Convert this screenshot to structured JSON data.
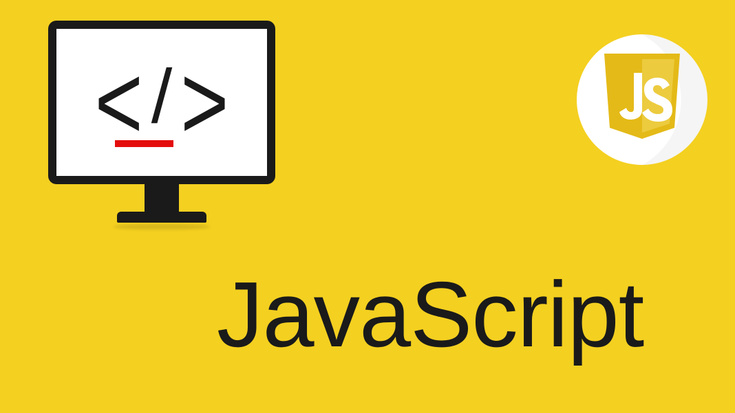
{
  "title": "JavaScript",
  "monitor": {
    "code_fragment": {
      "lt": "<",
      "slash": "/",
      "gt": ">"
    }
  },
  "badge": {
    "label": "JS",
    "shield_color": "#e4ba18",
    "shield_highlight": "#eccb3e",
    "circle_bg": "#ffffff"
  },
  "colors": {
    "background": "#f4d020",
    "accent_red": "#e40d0d",
    "dark": "#1a1a1a"
  }
}
